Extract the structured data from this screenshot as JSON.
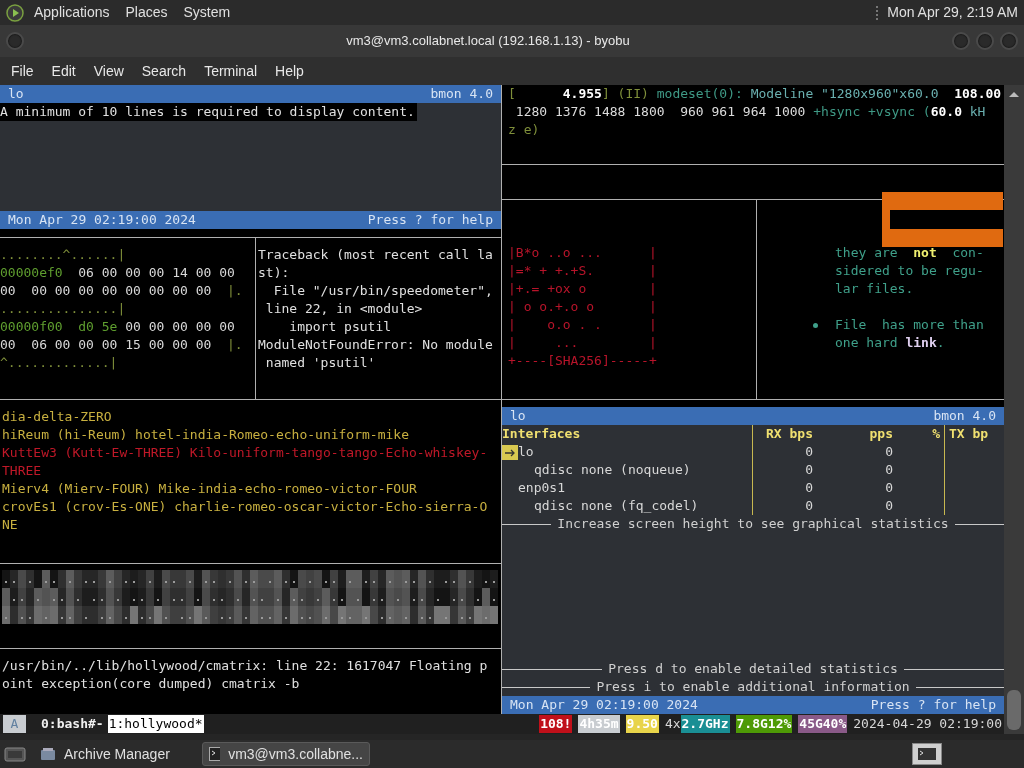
{
  "top_panel": {
    "menus": [
      "Applications",
      "Places",
      "System"
    ],
    "clock": "Mon Apr 29, 2:19 AM"
  },
  "window": {
    "title": "vm3@vm3.collabnet.local (192.168.1.13) - byobu",
    "menu": [
      "File",
      "Edit",
      "View",
      "Search",
      "Terminal",
      "Help"
    ]
  },
  "bmon_top": {
    "interface": "lo",
    "version": "bmon 4.0",
    "message": "A minimum of 10 lines is required to display content.",
    "timestamp": "Mon Apr 29 02:19:00 2024",
    "help": "Press ? for help"
  },
  "hexdump": {
    "lines": [
      [
        {
          "kind": "dim",
          "text": "........^......|"
        }
      ],
      [
        {
          "kind": "offset",
          "text": "00000ef0"
        },
        {
          "kind": "byte",
          "text": "  06 00 00 00 14 00 00"
        }
      ],
      [
        {
          "kind": "byte",
          "text": "00  00 00 00 00 00 00 00 00  "
        },
        {
          "kind": "dim",
          "text": "|."
        }
      ],
      [
        {
          "kind": "dim",
          "text": "...............|"
        }
      ],
      [
        {
          "kind": "offset",
          "text": "00000f00  d0 5e"
        },
        {
          "kind": "byte",
          "text": " 00 00 00 00 00"
        }
      ],
      [
        {
          "kind": "byte",
          "text": "00  06 00 00 00 15 00 00 00  "
        },
        {
          "kind": "dim",
          "text": "|."
        }
      ],
      [
        {
          "kind": "dim",
          "text": "^.............|"
        }
      ]
    ]
  },
  "traceback": [
    "Traceback (most recent call la",
    "st):",
    "  File \"/usr/bin/speedometer\",",
    " line 22, in <module>",
    "    import psutil",
    "ModuleNotFoundError: No module",
    " named 'psutil'"
  ],
  "callsigns": [
    {
      "kind": "normal",
      "text": "dia-delta-ZERO"
    },
    {
      "kind": "normal",
      "text": "hiReum (hi-Reum) hotel-india-Romeo-echo-uniform-mike"
    },
    {
      "kind": "alert",
      "text": "KuttEw3 (Kutt-Ew-THREE) Kilo-uniform-tango-tango-Echo-whiskey-"
    },
    {
      "kind": "alert",
      "text": "THREE"
    },
    {
      "kind": "normal",
      "text": "Mierv4 (Mierv-FOUR) Mike-india-echo-romeo-victor-FOUR"
    },
    {
      "kind": "normal",
      "text": "crovEs1 (crov-Es-ONE) charlie-romeo-oscar-victor-Echo-sierra-O"
    },
    {
      "kind": "normal",
      "text": "NE"
    }
  ],
  "cmatrix_error": [
    "/usr/bin/../lib/hollywood/cmatrix: line 22: 1617047 Floating p",
    "oint exception(core dumped) cmatrix -b"
  ],
  "modeline": [
    [
      {
        "kind": "dim",
        "text": "[      "
      },
      {
        "kind": "bold",
        "text": "4.955"
      },
      {
        "kind": "dim",
        "text": "] (II) "
      },
      {
        "kind": "green",
        "text": "modeset(0): "
      },
      {
        "kind": "plain",
        "text": "Modeline \"1280x960\"x60.0  "
      },
      {
        "kind": "bold",
        "text": "108.00"
      }
    ],
    [
      {
        "kind": "white",
        "text": " 1280 1376 1488 1800  960 961 964 1000"
      },
      {
        "kind": "green",
        "text": " +hsync +vsync ("
      },
      {
        "kind": "bold",
        "text": "60.0"
      },
      {
        "kind": "plain",
        "text": " kH"
      }
    ],
    [
      {
        "kind": "dim",
        "text": "z e)"
      }
    ]
  ],
  "sha_art": [
    "|B*o ..o ...      |",
    "|=* + +.+S.       |",
    "|+.= +ox o        |",
    "| o o.+.o o       |",
    "|    o.o . .      |",
    "|     ...         |",
    "+----[SHA256]-----+"
  ],
  "man_page": [
    {
      "bullet": false,
      "lines": [
        [
          {
            "kind": "text",
            "text": "they are  "
          },
          {
            "kind": "bold",
            "text": "not"
          },
          {
            "kind": "text",
            "text": "  con-"
          }
        ],
        [
          {
            "kind": "text",
            "text": "sidered to be regu-"
          }
        ],
        [
          {
            "kind": "text",
            "text": "lar files."
          }
        ]
      ]
    },
    {
      "bullet": true,
      "lines": [
        [
          {
            "kind": "text",
            "text": "File  has more than"
          }
        ],
        [
          {
            "kind": "text",
            "text": "one hard "
          },
          {
            "kind": "link",
            "text": "link"
          },
          {
            "kind": "text",
            "text": "."
          }
        ]
      ]
    }
  ],
  "bmon_main": {
    "interface": "lo",
    "version": "bmon 4.0",
    "columns": [
      "Interfaces",
      "RX bps",
      "pps",
      "%",
      "TX bp"
    ],
    "rows": [
      {
        "name": "lo",
        "rx_bps": "0",
        "pps": "0",
        "selected": true,
        "children": [
          {
            "name": "qdisc none (noqueue)",
            "rx_bps": "0",
            "pps": "0",
            "selected": false
          }
        ]
      },
      {
        "name": "enp0s1",
        "rx_bps": "0",
        "pps": "0",
        "selected": false,
        "children": [
          {
            "name": "qdisc none (fq_codel)",
            "rx_bps": "0",
            "pps": "0",
            "selected": false
          }
        ]
      }
    ],
    "graph_hint": "Increase screen height to see graphical statistics",
    "hints": [
      "Press d to enable detailed statistics",
      "Press i to enable additional information"
    ],
    "timestamp": "Mon Apr 29 02:19:00 2024",
    "help": "Press ? for help"
  },
  "status_bar": {
    "session": "A",
    "windows": [
      {
        "label": "0:bash#-",
        "selected": false
      },
      {
        "label": "1:hollywood*",
        "selected": true
      }
    ],
    "stats": [
      {
        "text": "108!",
        "color": "#c0101a"
      },
      {
        "text": "4h35m",
        "color": "#c8ccd0"
      },
      {
        "text": "9.50",
        "color": "#e8d44a"
      },
      {
        "prefix": "4x",
        "text": "2.7GHz",
        "color": "#1a8f94"
      },
      {
        "text": "7.8G12%",
        "color": "#4e9a06"
      },
      {
        "text": "45G40%",
        "color": "#8a5a88"
      }
    ],
    "datetime": "2024-04-29 02:19:00"
  },
  "taskbar": {
    "items": [
      {
        "label": "Archive Manager",
        "selected": false
      },
      {
        "label": "vm3@vm3.collabne...",
        "selected": true
      }
    ]
  }
}
